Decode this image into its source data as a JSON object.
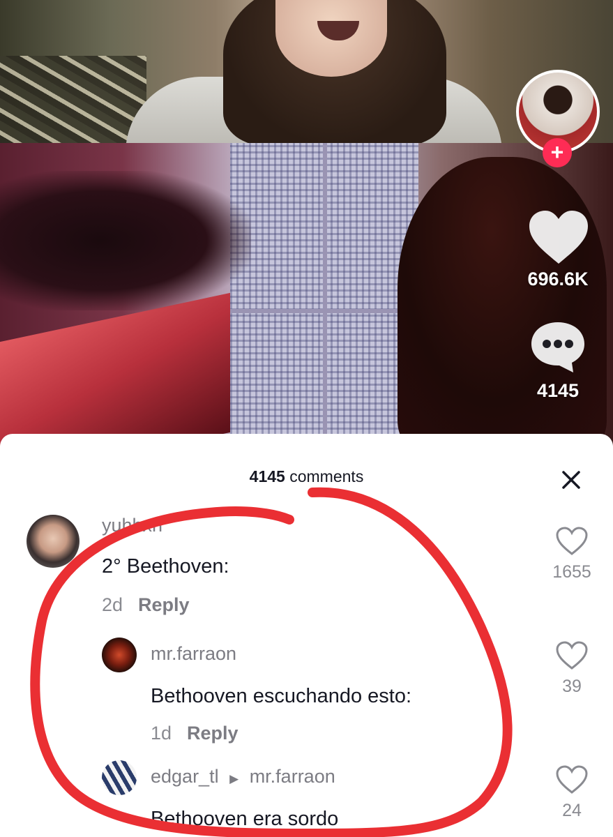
{
  "stats": {
    "likes": "696.6K",
    "comments": "4145"
  },
  "sheet": {
    "count": "4145",
    "label": "comments"
  },
  "comments": [
    {
      "username": "yuhhxn",
      "text": "2° Beethoven:",
      "time": "2d",
      "reply_label": "Reply",
      "likes": "1655"
    },
    {
      "username": "mr.farraon",
      "text": "Bethooven escuchando esto:",
      "time": "1d",
      "reply_label": "Reply",
      "likes": "39"
    },
    {
      "username": "edgar_tl",
      "reply_to": "mr.farraon",
      "text": "Bethooven era sordo",
      "likes": "24"
    }
  ],
  "colors": {
    "accent": "#fe2c55",
    "annotation": "#ea2f33"
  }
}
